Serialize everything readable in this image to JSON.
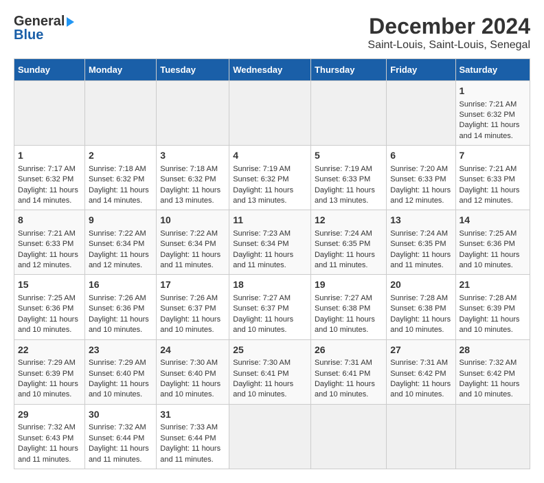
{
  "header": {
    "logo_line1": "General",
    "logo_line2": "Blue",
    "main_title": "December 2024",
    "subtitle": "Saint-Louis, Saint-Louis, Senegal"
  },
  "calendar": {
    "days_of_week": [
      "Sunday",
      "Monday",
      "Tuesday",
      "Wednesday",
      "Thursday",
      "Friday",
      "Saturday"
    ],
    "weeks": [
      [
        null,
        null,
        null,
        null,
        null,
        null,
        {
          "day": 1,
          "sunrise": "7:21 AM",
          "sunset": "6:32 PM",
          "daylight": "11 hours and 14 minutes"
        }
      ],
      [
        null,
        null,
        null,
        null,
        null,
        null,
        null
      ]
    ],
    "rows": [
      {
        "cells": [
          {
            "day": null
          },
          {
            "day": null
          },
          {
            "day": null
          },
          {
            "day": null
          },
          {
            "day": null
          },
          {
            "day": null
          },
          {
            "day": 1,
            "sunrise": "7:21 AM",
            "sunset": "6:32 PM",
            "daylight": "11 hours and 14 minutes"
          }
        ]
      },
      {
        "cells": [
          {
            "day": 1,
            "sunrise": "7:17 AM",
            "sunset": "6:32 PM",
            "daylight": "11 hours and 14 minutes"
          },
          {
            "day": 2,
            "sunrise": "7:18 AM",
            "sunset": "6:32 PM",
            "daylight": "11 hours and 14 minutes"
          },
          {
            "day": 3,
            "sunrise": "7:18 AM",
            "sunset": "6:32 PM",
            "daylight": "11 hours and 13 minutes"
          },
          {
            "day": 4,
            "sunrise": "7:19 AM",
            "sunset": "6:32 PM",
            "daylight": "11 hours and 13 minutes"
          },
          {
            "day": 5,
            "sunrise": "7:19 AM",
            "sunset": "6:33 PM",
            "daylight": "11 hours and 13 minutes"
          },
          {
            "day": 6,
            "sunrise": "7:20 AM",
            "sunset": "6:33 PM",
            "daylight": "11 hours and 12 minutes"
          },
          {
            "day": 7,
            "sunrise": "7:21 AM",
            "sunset": "6:33 PM",
            "daylight": "11 hours and 12 minutes"
          }
        ]
      },
      {
        "cells": [
          {
            "day": 8,
            "sunrise": "7:21 AM",
            "sunset": "6:33 PM",
            "daylight": "11 hours and 12 minutes"
          },
          {
            "day": 9,
            "sunrise": "7:22 AM",
            "sunset": "6:34 PM",
            "daylight": "11 hours and 12 minutes"
          },
          {
            "day": 10,
            "sunrise": "7:22 AM",
            "sunset": "6:34 PM",
            "daylight": "11 hours and 11 minutes"
          },
          {
            "day": 11,
            "sunrise": "7:23 AM",
            "sunset": "6:34 PM",
            "daylight": "11 hours and 11 minutes"
          },
          {
            "day": 12,
            "sunrise": "7:24 AM",
            "sunset": "6:35 PM",
            "daylight": "11 hours and 11 minutes"
          },
          {
            "day": 13,
            "sunrise": "7:24 AM",
            "sunset": "6:35 PM",
            "daylight": "11 hours and 11 minutes"
          },
          {
            "day": 14,
            "sunrise": "7:25 AM",
            "sunset": "6:36 PM",
            "daylight": "11 hours and 10 minutes"
          }
        ]
      },
      {
        "cells": [
          {
            "day": 15,
            "sunrise": "7:25 AM",
            "sunset": "6:36 PM",
            "daylight": "11 hours and 10 minutes"
          },
          {
            "day": 16,
            "sunrise": "7:26 AM",
            "sunset": "6:36 PM",
            "daylight": "11 hours and 10 minutes"
          },
          {
            "day": 17,
            "sunrise": "7:26 AM",
            "sunset": "6:37 PM",
            "daylight": "11 hours and 10 minutes"
          },
          {
            "day": 18,
            "sunrise": "7:27 AM",
            "sunset": "6:37 PM",
            "daylight": "11 hours and 10 minutes"
          },
          {
            "day": 19,
            "sunrise": "7:27 AM",
            "sunset": "6:38 PM",
            "daylight": "11 hours and 10 minutes"
          },
          {
            "day": 20,
            "sunrise": "7:28 AM",
            "sunset": "6:38 PM",
            "daylight": "11 hours and 10 minutes"
          },
          {
            "day": 21,
            "sunrise": "7:28 AM",
            "sunset": "6:39 PM",
            "daylight": "11 hours and 10 minutes"
          }
        ]
      },
      {
        "cells": [
          {
            "day": 22,
            "sunrise": "7:29 AM",
            "sunset": "6:39 PM",
            "daylight": "11 hours and 10 minutes"
          },
          {
            "day": 23,
            "sunrise": "7:29 AM",
            "sunset": "6:40 PM",
            "daylight": "11 hours and 10 minutes"
          },
          {
            "day": 24,
            "sunrise": "7:30 AM",
            "sunset": "6:40 PM",
            "daylight": "11 hours and 10 minutes"
          },
          {
            "day": 25,
            "sunrise": "7:30 AM",
            "sunset": "6:41 PM",
            "daylight": "11 hours and 10 minutes"
          },
          {
            "day": 26,
            "sunrise": "7:31 AM",
            "sunset": "6:41 PM",
            "daylight": "11 hours and 10 minutes"
          },
          {
            "day": 27,
            "sunrise": "7:31 AM",
            "sunset": "6:42 PM",
            "daylight": "11 hours and 10 minutes"
          },
          {
            "day": 28,
            "sunrise": "7:32 AM",
            "sunset": "6:42 PM",
            "daylight": "11 hours and 10 minutes"
          }
        ]
      },
      {
        "cells": [
          {
            "day": 29,
            "sunrise": "7:32 AM",
            "sunset": "6:43 PM",
            "daylight": "11 hours and 11 minutes"
          },
          {
            "day": 30,
            "sunrise": "7:32 AM",
            "sunset": "6:44 PM",
            "daylight": "11 hours and 11 minutes"
          },
          {
            "day": 31,
            "sunrise": "7:33 AM",
            "sunset": "6:44 PM",
            "daylight": "11 hours and 11 minutes"
          },
          {
            "day": null
          },
          {
            "day": null
          },
          {
            "day": null
          },
          {
            "day": null
          }
        ]
      }
    ]
  }
}
